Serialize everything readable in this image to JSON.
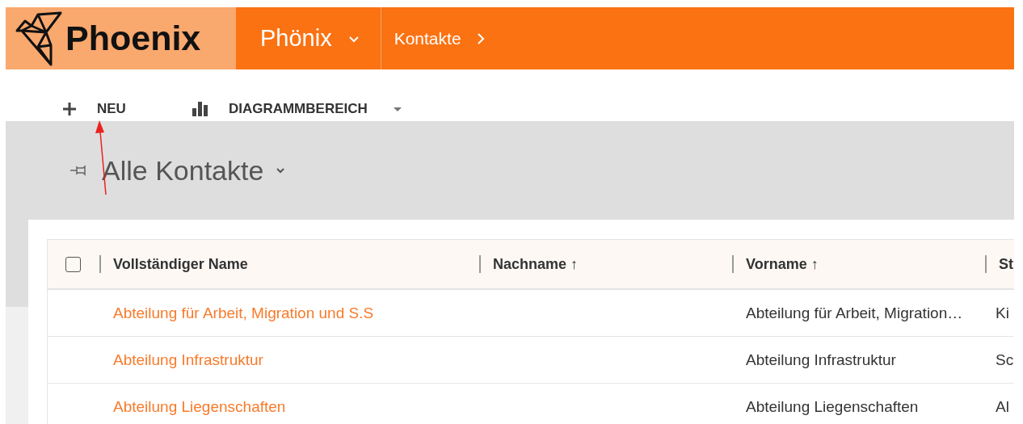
{
  "header": {
    "logo": "Phoenix",
    "app": "Phönix",
    "breadcrumb": "Kontakte"
  },
  "toolbar": [
    {
      "kind": "add",
      "label": "NEU",
      "dropdown": false
    },
    {
      "kind": "chart",
      "label": "DIAGRAMMBEREICH",
      "dropdown": true
    }
  ],
  "view": {
    "title": "Alle Kontakte"
  },
  "table": {
    "select_all": {
      "checked": false
    },
    "columns": [
      {
        "label": "Vollständiger Name"
      },
      {
        "label": "Nachname",
        "sort_indicator": "↑"
      },
      {
        "label": "Vorname",
        "sort_indicator": "↑"
      },
      {
        "label": "St"
      }
    ],
    "rows": [
      [
        "Abteilung für Arbeit, Migration und S.S",
        null,
        "Abteilung für Arbeit, Migration…",
        "Ki"
      ],
      [
        "Abteilung Infrastruktur",
        null,
        "Abteilung Infrastruktur",
        "Sc"
      ],
      [
        "Abteilung Liegenschaften",
        null,
        "Abteilung Liegenschaften",
        "Al"
      ]
    ]
  }
}
